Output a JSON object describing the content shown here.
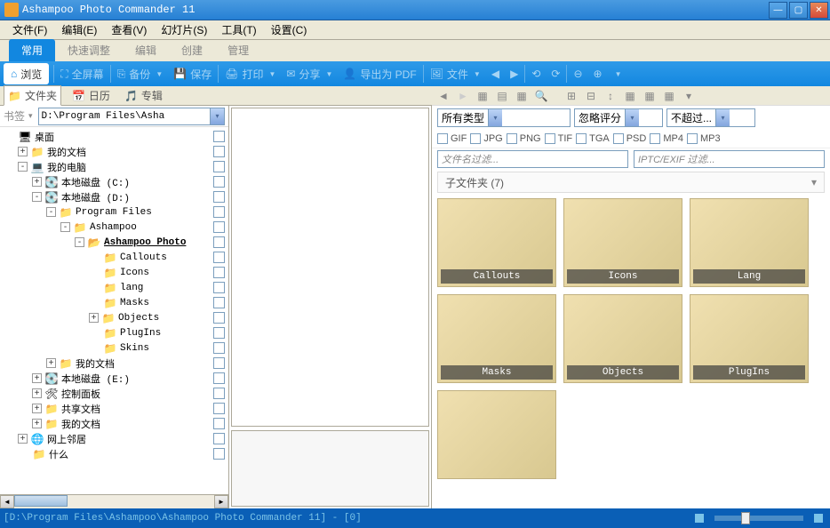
{
  "window": {
    "title": "Ashampoo Photo Commander 11"
  },
  "menubar": [
    "文件(F)",
    "编辑(E)",
    "查看(V)",
    "幻灯片(S)",
    "工具(T)",
    "设置(C)"
  ],
  "tabs": [
    {
      "label": "常用",
      "active": true
    },
    {
      "label": "快速调整",
      "active": false
    },
    {
      "label": "编辑",
      "active": false
    },
    {
      "label": "创建",
      "active": false
    },
    {
      "label": "管理",
      "active": false
    }
  ],
  "toolbar": {
    "browse": "浏览",
    "fullscreen": "全屏幕",
    "backup": "备份",
    "save": "保存",
    "print": "打印",
    "share": "分享",
    "export_pdf": "导出为 PDF",
    "file": "文件"
  },
  "subtabs": {
    "folders": "文件夹",
    "calendar": "日历",
    "album": "专辑"
  },
  "sidebar": {
    "bookmark_label": "书签",
    "path_value": "D:\\Program Files\\Asha",
    "tree": [
      {
        "depth": 0,
        "exp": "",
        "icon": "desktop",
        "label": "桌面"
      },
      {
        "depth": 1,
        "exp": "+",
        "icon": "folder",
        "label": "我的文档"
      },
      {
        "depth": 1,
        "exp": "-",
        "icon": "computer",
        "label": "我的电脑"
      },
      {
        "depth": 2,
        "exp": "+",
        "icon": "drive",
        "label": "本地磁盘 (C:)"
      },
      {
        "depth": 2,
        "exp": "-",
        "icon": "drive",
        "label": "本地磁盘 (D:)"
      },
      {
        "depth": 3,
        "exp": "-",
        "icon": "folder",
        "label": "Program Files"
      },
      {
        "depth": 4,
        "exp": "-",
        "icon": "folder",
        "label": "Ashampoo"
      },
      {
        "depth": 5,
        "exp": "-",
        "icon": "folder-open",
        "label": "Ashampoo Photo",
        "bold": true
      },
      {
        "depth": 6,
        "exp": "",
        "icon": "folder",
        "label": "Callouts"
      },
      {
        "depth": 6,
        "exp": "",
        "icon": "folder",
        "label": "Icons"
      },
      {
        "depth": 6,
        "exp": "",
        "icon": "folder",
        "label": "lang"
      },
      {
        "depth": 6,
        "exp": "",
        "icon": "folder",
        "label": "Masks"
      },
      {
        "depth": 6,
        "exp": "+",
        "icon": "folder",
        "label": "Objects"
      },
      {
        "depth": 6,
        "exp": "",
        "icon": "folder",
        "label": "PlugIns"
      },
      {
        "depth": 6,
        "exp": "",
        "icon": "folder",
        "label": "Skins"
      },
      {
        "depth": 3,
        "exp": "+",
        "icon": "folder",
        "label": "我的文档"
      },
      {
        "depth": 2,
        "exp": "+",
        "icon": "drive",
        "label": "本地磁盘 (E:)"
      },
      {
        "depth": 2,
        "exp": "+",
        "icon": "control",
        "label": "控制面板"
      },
      {
        "depth": 2,
        "exp": "+",
        "icon": "folder",
        "label": "共享文档"
      },
      {
        "depth": 2,
        "exp": "+",
        "icon": "folder",
        "label": "我的文档"
      },
      {
        "depth": 1,
        "exp": "+",
        "icon": "network",
        "label": "网上邻居"
      },
      {
        "depth": 1,
        "exp": "",
        "icon": "folder",
        "label": "什么"
      }
    ]
  },
  "right": {
    "filters": {
      "type": "所有类型",
      "rating": "忽略评分",
      "date": "不超过..."
    },
    "formats": [
      "GIF",
      "JPG",
      "PNG",
      "TIF",
      "TGA",
      "PSD",
      "MP4",
      "MP3"
    ],
    "filename_filter": "文件名过滤...",
    "iptc_filter": "IPTC/EXIF 过滤...",
    "subfolder_header": "子文件夹 (7)",
    "thumbs": [
      "Callouts",
      "Icons",
      "Lang",
      "Masks",
      "Objects",
      "PlugIns",
      ""
    ]
  },
  "statusbar": {
    "path": "[D:\\Program Files\\Ashampoo\\Ashampoo Photo Commander 11] - [0]"
  }
}
